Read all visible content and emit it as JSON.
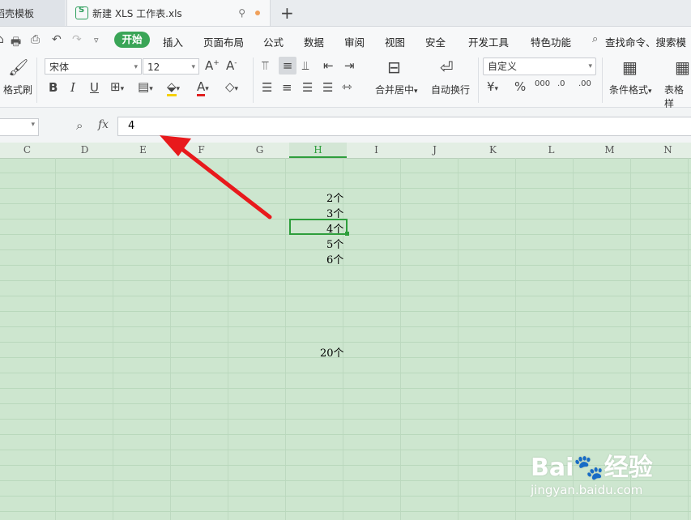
{
  "tabs": {
    "tab1_label": "稻壳模板",
    "tab2_label": "新建 XLS 工作表.xls",
    "new_tab_symbol": "+"
  },
  "menu": {
    "items": [
      "开始",
      "插入",
      "页面布局",
      "公式",
      "数据",
      "审阅",
      "视图",
      "安全",
      "开发工具",
      "特色功能"
    ],
    "search_label": "查找命令、搜索模板"
  },
  "ribbon": {
    "format_painter": "格式刷",
    "font_name": "宋体",
    "font_size": "12",
    "number_format": "自定义",
    "merge_center": "合并居中",
    "auto_wrap": "自动换行",
    "conditional_format": "条件格式",
    "table_style": "表格样"
  },
  "formula_bar": {
    "fx_label": "fx",
    "value": "4"
  },
  "columns": [
    "C",
    "D",
    "E",
    "F",
    "G",
    "H",
    "I",
    "J",
    "K",
    "L",
    "M",
    "N"
  ],
  "selected_column": "H",
  "cells": [
    {
      "text": "2个"
    },
    {
      "text": "3个"
    },
    {
      "text": "4个"
    },
    {
      "text": "5个"
    },
    {
      "text": "6个"
    },
    {
      "text": "20个"
    }
  ],
  "watermark": {
    "logo": "Bai🐾经验",
    "url": "jingyan.baidu.com"
  },
  "colors": {
    "accent": "#3aa557",
    "grid_bg": "#cde6cf",
    "arrow": "#e8191c"
  }
}
